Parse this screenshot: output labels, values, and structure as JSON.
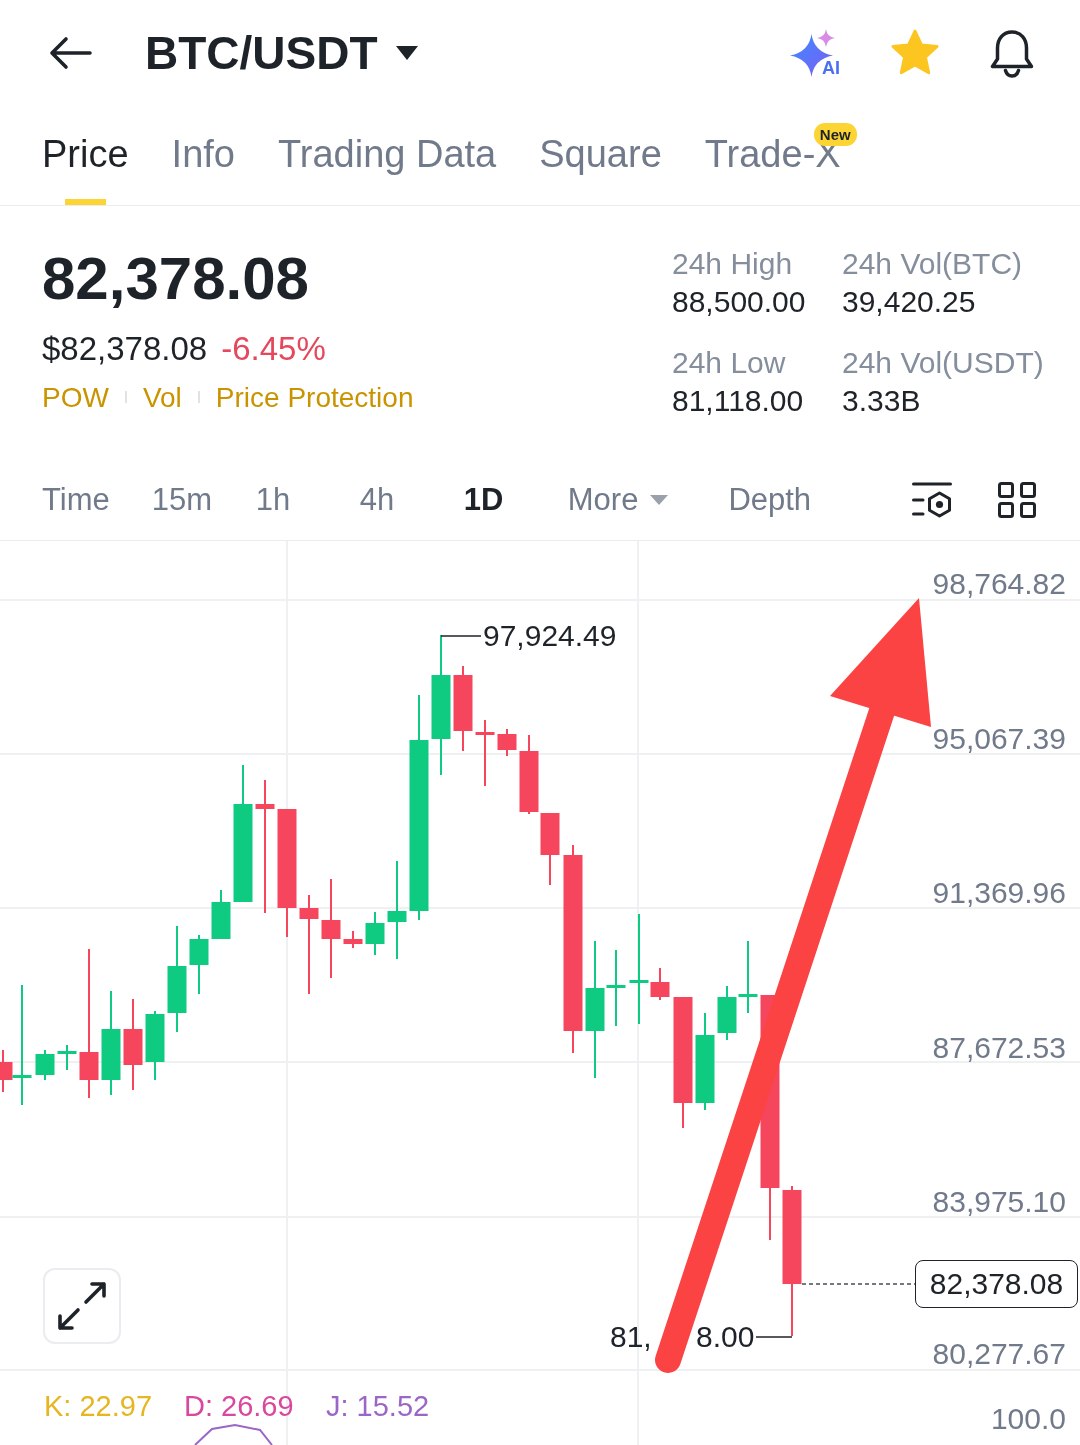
{
  "header": {
    "title": "BTC/USDT",
    "ai_label": "AI",
    "favorite": true
  },
  "tabs": [
    {
      "label": "Price",
      "selected": true
    },
    {
      "label": "Info",
      "selected": false
    },
    {
      "label": "Trading Data",
      "selected": false
    },
    {
      "label": "Square",
      "selected": false
    },
    {
      "label": "Trade-X",
      "selected": false,
      "badge": "New"
    }
  ],
  "price": {
    "last": "82,378.08",
    "fiat": "$82,378.08",
    "change": "-6.45%",
    "tags": [
      "POW",
      "Vol",
      "Price Protection"
    ]
  },
  "stats": [
    {
      "label": "24h High",
      "value": "88,500.00"
    },
    {
      "label": "24h Vol(BTC)",
      "value": "39,420.25"
    },
    {
      "label": "24h Low",
      "value": "81,118.00"
    },
    {
      "label": "24h Vol(USDT)",
      "value": "3.33B"
    }
  ],
  "intervals": [
    {
      "label": "Time",
      "kind": "option",
      "selected": false
    },
    {
      "label": "15m",
      "kind": "option",
      "selected": false
    },
    {
      "label": "1h",
      "kind": "option",
      "selected": false
    },
    {
      "label": "4h",
      "kind": "option",
      "selected": false
    },
    {
      "label": "1D",
      "kind": "option",
      "selected": true
    },
    {
      "label": "More",
      "kind": "menu",
      "selected": false
    },
    {
      "label": "Depth",
      "kind": "option",
      "selected": false
    }
  ],
  "chart": {
    "price_axis": [
      "98,764.82",
      "95,067.39",
      "91,369.96",
      "87,672.53",
      "83,975.10",
      "80,277.67"
    ],
    "high_label": "97,924.49",
    "low_label_parts": [
      "81,",
      "8.00"
    ],
    "current_price": "82,378.08"
  },
  "indicator": {
    "values": [
      {
        "label": "K: 22.97",
        "color": "#e6b520"
      },
      {
        "label": "D: 26.69",
        "color": "#d9479e"
      },
      {
        "label": "J: 15.52",
        "color": "#9a66c8"
      }
    ],
    "axis_label": "100.0"
  }
}
